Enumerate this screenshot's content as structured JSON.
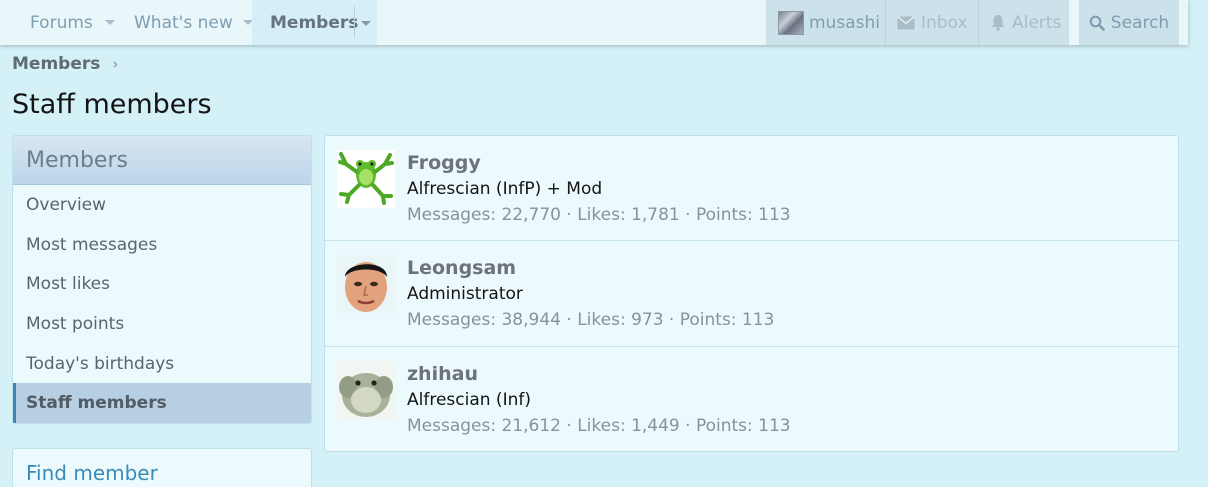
{
  "nav": {
    "tabs": [
      {
        "label": "Forums"
      },
      {
        "label": "What's new"
      },
      {
        "label": "Members"
      }
    ],
    "user": {
      "name": "musashi"
    },
    "inbox": "Inbox",
    "alerts": "Alerts",
    "search": "Search"
  },
  "breadcrumb": {
    "label": "Members",
    "separator": "›"
  },
  "page_title": "Staff members",
  "sidebar": {
    "heading": "Members",
    "items": [
      {
        "label": "Overview"
      },
      {
        "label": "Most messages"
      },
      {
        "label": "Most likes"
      },
      {
        "label": "Most points"
      },
      {
        "label": "Today's birthdays"
      },
      {
        "label": "Staff members"
      }
    ],
    "find_member": "Find member"
  },
  "members": [
    {
      "name": "Froggy",
      "role": "Alfrescian (InfP) + Mod",
      "stats": "Messages: 22,770 · Likes: 1,781 · Points: 113"
    },
    {
      "name": "Leongsam",
      "role": "Administrator",
      "stats": "Messages: 38,944 · Likes: 973 · Points: 113"
    },
    {
      "name": "zhihau",
      "role": "Alfrescian (Inf)",
      "stats": "Messages: 21,612 · Likes: 1,449 · Points: 113"
    }
  ],
  "colors": {
    "background": "#d3f1f7",
    "nav_background": "#e9f7fa",
    "link": "#3b8bb8",
    "active_item": "#b6cfe3"
  }
}
